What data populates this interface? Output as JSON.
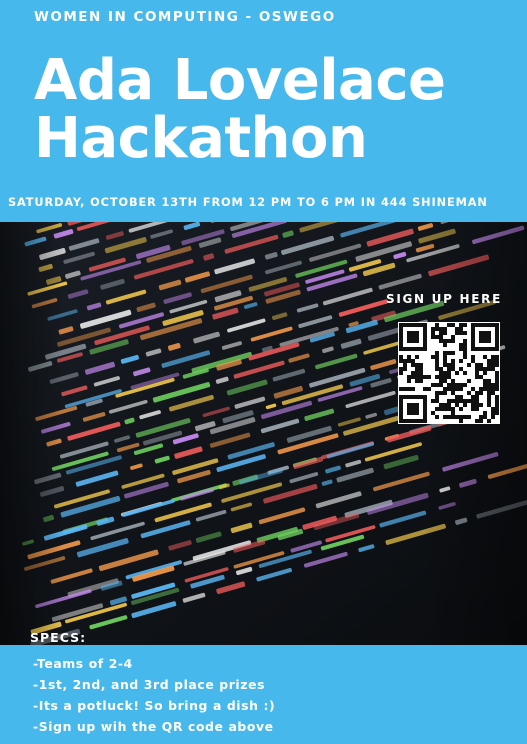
{
  "poster": {
    "organization": "WOMEN IN COMPUTING - OSWEGO",
    "title_line1": "Ada Lovelace",
    "title_line2": "Hackathon",
    "event_details": "SATURDAY, OCTOBER 13TH FROM 12 PM TO 6 PM IN 444 SHINEMAN",
    "signup_label": "SIGN UP HERE",
    "specs_heading": "SPECS:",
    "specs": [
      "-Teams of 2-4",
      "-1st, 2nd, and 3rd place prizes",
      "-Its a potluck! So bring a dish :)",
      "-Sign up wih the QR code above"
    ],
    "colors": {
      "accent": "#46b8ec",
      "text": "#ffffff",
      "photo_background": "#0f1216"
    },
    "icons": {
      "qr": "qr-code-icon"
    }
  }
}
